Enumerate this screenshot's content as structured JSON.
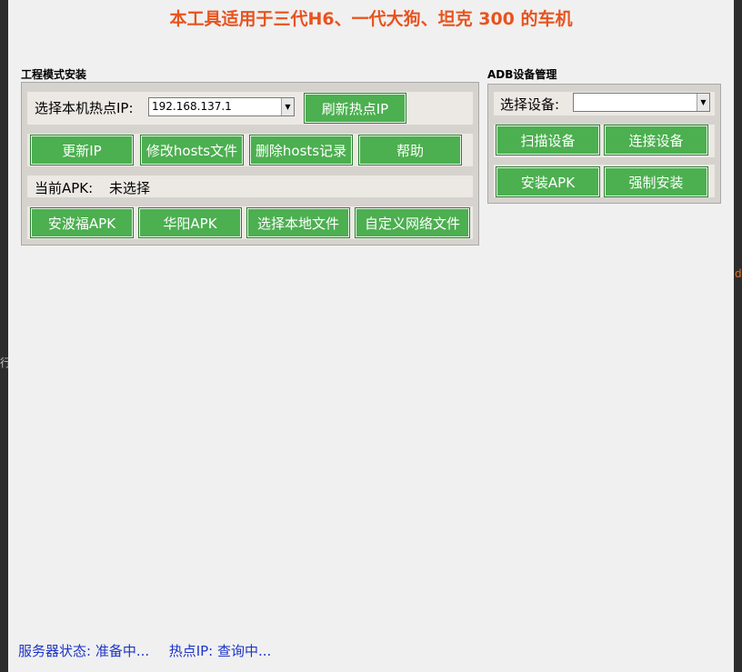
{
  "title": "本工具适用于三代H6、一代大狗、坦克 300 的车机",
  "left_group": {
    "title": "工程模式安装",
    "hotspot_label": "选择本机热点IP:",
    "hotspot_ip": "192.168.137.1",
    "refresh_button": "刷新热点IP",
    "buttons_row1": [
      "更新IP",
      "修改hosts文件",
      "删除hosts记录",
      "帮助"
    ],
    "current_apk_label": "当前APK:",
    "current_apk_value": "未选择",
    "buttons_row2": [
      "安波福APK",
      "华阳APK",
      "选择本地文件",
      "自定义网络文件"
    ]
  },
  "right_group": {
    "title": "ADB设备管理",
    "device_label": "选择设备:",
    "device_value": "",
    "buttons_row1": [
      "扫描设备",
      "连接设备"
    ],
    "buttons_row2": [
      "安装APK",
      "强制安装"
    ]
  },
  "status": {
    "server": "服务器状态: 准备中...",
    "hotspot": "热点IP: 查询中..."
  },
  "side_marks": {
    "right": "d",
    "left": "行"
  },
  "colors": {
    "title": "#e8531e",
    "button": "#4caf50",
    "status_text": "#1c34c8"
  }
}
